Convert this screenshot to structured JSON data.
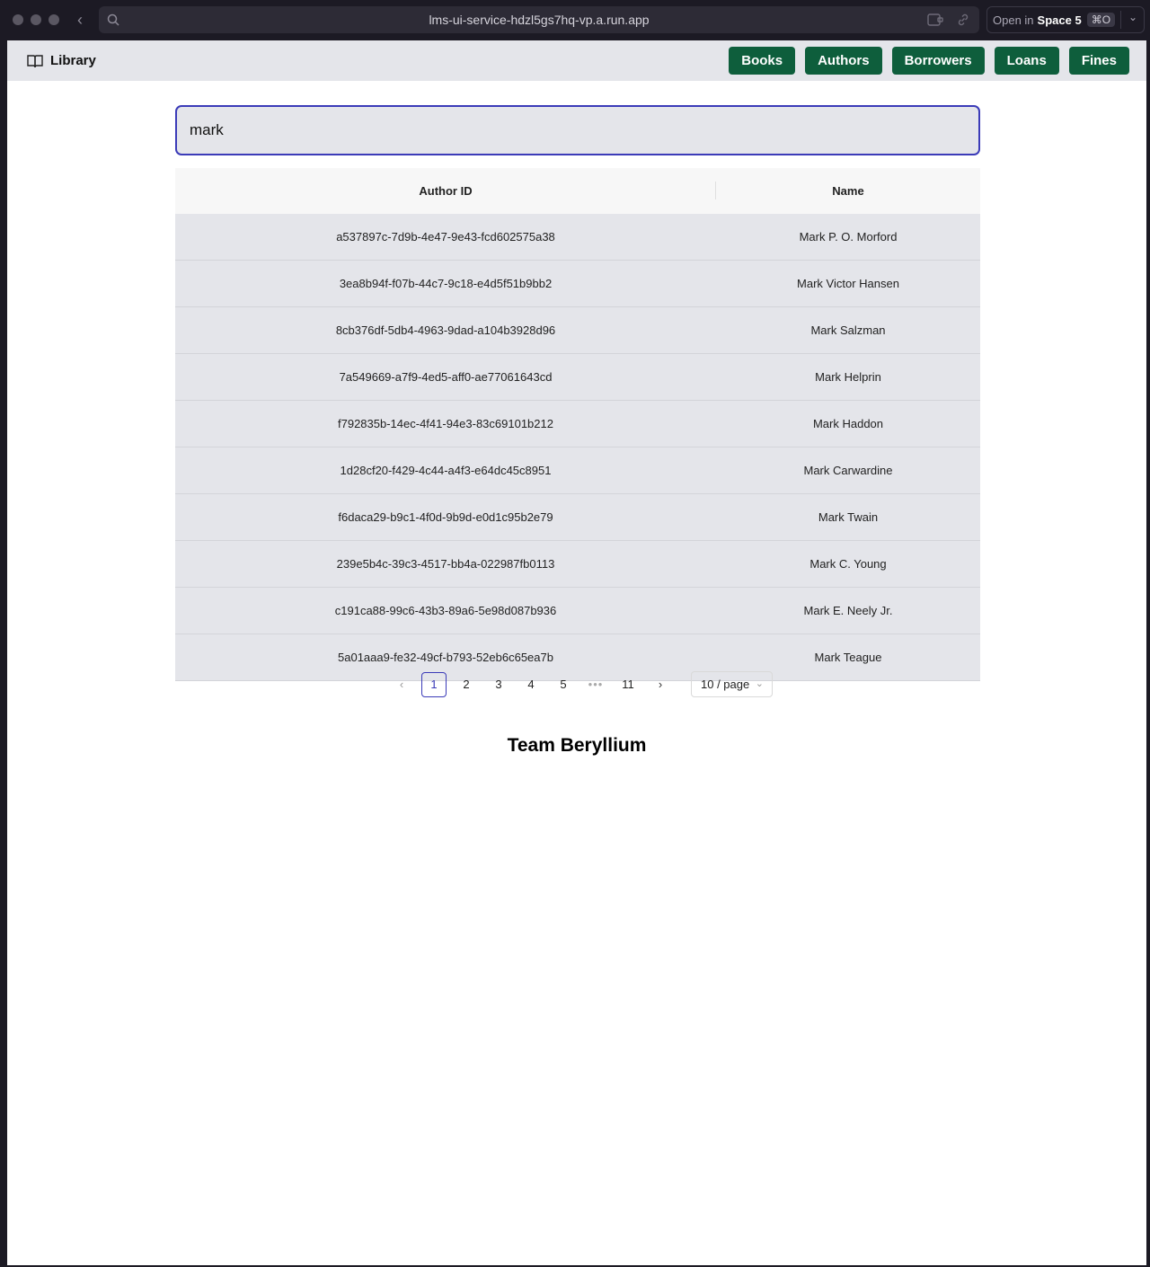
{
  "browser": {
    "url": "lms-ui-service-hdzl5gs7hq-vp.a.run.app",
    "open_in_prefix": "Open in",
    "open_in_space": "Space 5",
    "shortcut": "⌘O"
  },
  "navbar": {
    "brand": "Library",
    "buttons": [
      "Books",
      "Authors",
      "Borrowers",
      "Loans",
      "Fines"
    ]
  },
  "search": {
    "value": "mark"
  },
  "table": {
    "headers": [
      "Author ID",
      "Name"
    ],
    "rows": [
      [
        "a537897c-7d9b-4e47-9e43-fcd602575a38",
        "Mark P. O. Morford"
      ],
      [
        "3ea8b94f-f07b-44c7-9c18-e4d5f51b9bb2",
        "Mark Victor Hansen"
      ],
      [
        "8cb376df-5db4-4963-9dad-a104b3928d96",
        "Mark Salzman"
      ],
      [
        "7a549669-a7f9-4ed5-aff0-ae77061643cd",
        "Mark Helprin"
      ],
      [
        "f792835b-14ec-4f41-94e3-83c69101b212",
        "Mark Haddon"
      ],
      [
        "1d28cf20-f429-4c44-a4f3-e64dc45c8951",
        "Mark Carwardine"
      ],
      [
        "f6daca29-b9c1-4f0d-9b9d-e0d1c95b2e79",
        "Mark Twain"
      ],
      [
        "239e5b4c-39c3-4517-bb4a-022987fb0113",
        "Mark C. Young"
      ],
      [
        "c191ca88-99c6-43b3-89a6-5e98d087b936",
        "Mark E. Neely Jr."
      ],
      [
        "5a01aaa9-fe32-49cf-b793-52eb6c65ea7b",
        "Mark Teague"
      ]
    ]
  },
  "pagination": {
    "pages": [
      "1",
      "2",
      "3",
      "4",
      "5"
    ],
    "ellipsis": "•••",
    "last_page": "11",
    "current": "1",
    "page_size": "10 / page"
  },
  "footer": {
    "text": "Team Beryllium"
  },
  "colors": {
    "nav_button": "#0e5e3c",
    "accent": "#3b3bb8"
  }
}
